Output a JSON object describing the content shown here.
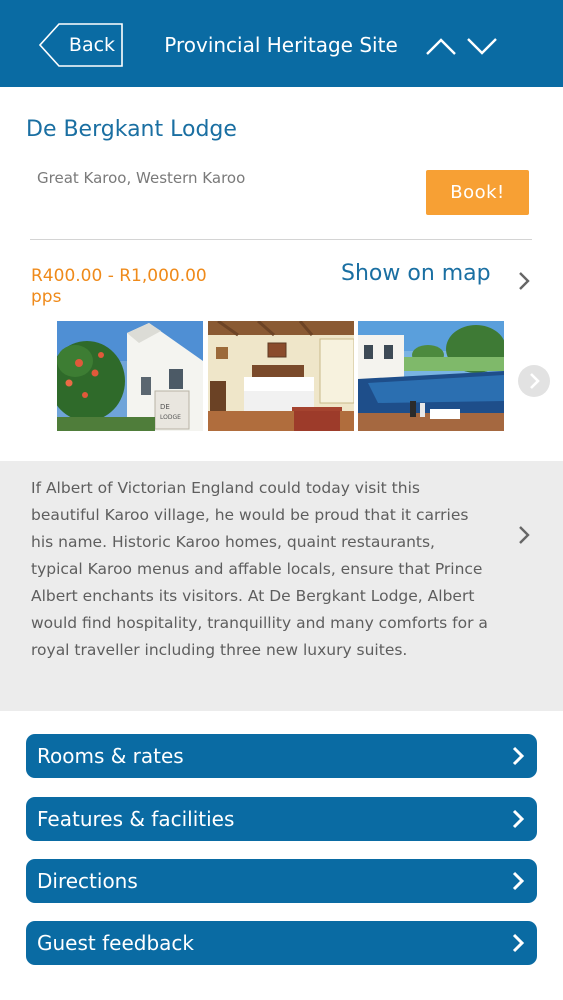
{
  "header": {
    "back_label": "Back",
    "title": "Provincial Heritage Site",
    "prev_icon": "chevron-up-icon",
    "next_icon": "chevron-down-icon",
    "background": "#0a6ba3"
  },
  "listing": {
    "name": "De Bergkant Lodge",
    "location": "Great Karoo, Western Karoo",
    "book_label": "Book!",
    "price_range": "R400.00 - R1,000.00",
    "price_unit": "pps",
    "map_label": "Show on map"
  },
  "colors": {
    "brand_blue": "#0a6ba3",
    "title_blue": "#1a6fa2",
    "accent_orange": "#f7a034",
    "price_orange": "#ef8a1a",
    "panel_gray": "#ececec"
  },
  "gallery": {
    "photos": [
      {
        "subject": "Lodge exterior with signboard and garden"
      },
      {
        "subject": "Bedroom with double bed"
      },
      {
        "subject": "Pool with wine glasses"
      }
    ],
    "next_icon": "circle-chevron-right-icon"
  },
  "description": "If Albert of Victorian England could today visit this beautiful Karoo village, he would be proud that it carries his name. Historic Karoo homes, quaint restaurants, typical Karoo menus and affable locals, ensure that Prince Albert enchants its visitors. At De Bergkant Lodge, Albert would find hospitality, tranquillity and many comforts for a royal traveller including three new luxury suites.",
  "actions": [
    {
      "label": "Rooms & rates"
    },
    {
      "label": "Features & facilities"
    },
    {
      "label": "Directions"
    },
    {
      "label": "Guest feedback"
    }
  ]
}
